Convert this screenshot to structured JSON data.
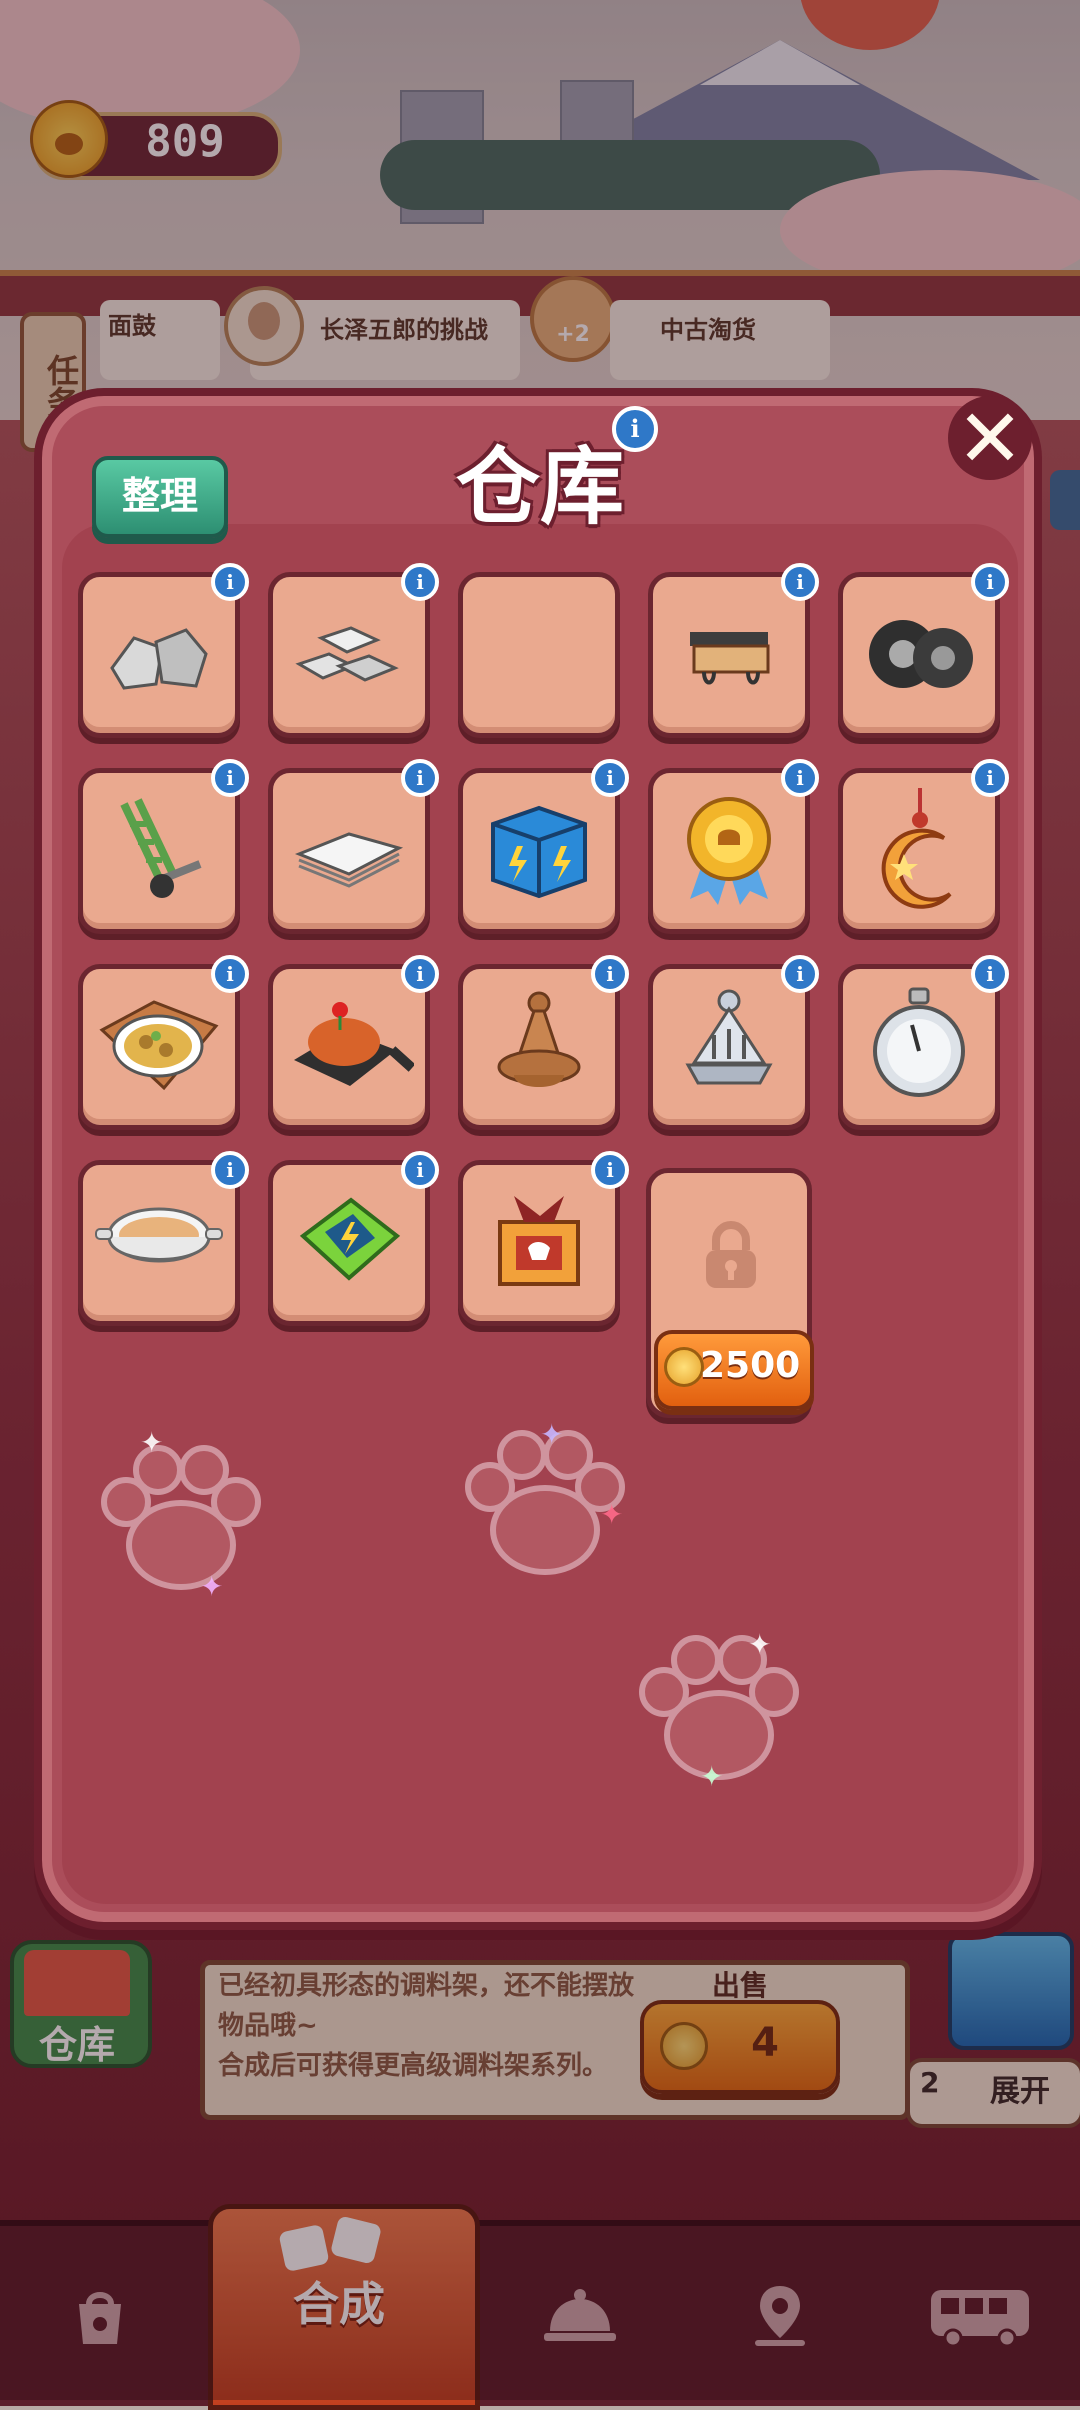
{
  "currency": {
    "amount": "809",
    "icon": "paw-coin-icon"
  },
  "top_strip": {
    "task_tab": "任务",
    "card_left": "面鼓",
    "challenge": "长泽五郎的挑战",
    "bonus": "+2",
    "card_right": "中古淘货"
  },
  "warehouse": {
    "title": "仓库",
    "sort_label": "整理",
    "close_icon": "close-icon",
    "unlock_cost": "2500",
    "slots": [
      {
        "item": "silver-ore"
      },
      {
        "item": "silver-ingots"
      },
      {
        "item": ""
      },
      {
        "item": "wall-shelf"
      },
      {
        "item": "tires"
      },
      {
        "item": "hand-truck"
      },
      {
        "item": "paper-stack"
      },
      {
        "item": "blue-toolbox"
      },
      {
        "item": "gold-medal"
      },
      {
        "item": "moon-ornament"
      },
      {
        "item": "curry-dish"
      },
      {
        "item": "sizzling-plate"
      },
      {
        "item": "wooden-lid"
      },
      {
        "item": "silver-dome"
      },
      {
        "item": "stopwatch"
      },
      {
        "item": "soup-bowl"
      },
      {
        "item": "green-battery"
      },
      {
        "item": "gift-box"
      }
    ]
  },
  "info_panel": {
    "line1": "已经初具形态的调料架，还不能摆放物品哦~",
    "line2": "合成后可获得更高级调料架系列。",
    "sell_label": "出售",
    "sell_price": "4",
    "warehouse_label": "仓库",
    "expand_count": "2",
    "expand_label": "展开"
  },
  "nav": {
    "items": [
      {
        "name": "bag-icon",
        "label": ""
      },
      {
        "name": "merge-icon",
        "label": "合成"
      },
      {
        "name": "service-bell-icon",
        "label": ""
      },
      {
        "name": "map-pin-icon",
        "label": ""
      },
      {
        "name": "bus-icon",
        "label": ""
      }
    ],
    "active_label": "合成"
  },
  "colors": {
    "dialog_bg": "#ab4d5a",
    "slot_bg": "#eaa98f",
    "info_blue": "#2f78c8",
    "sort_green": "#2d8f72",
    "unlock_orange": "#e2600f"
  }
}
